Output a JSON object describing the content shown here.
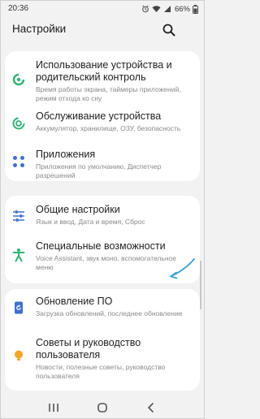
{
  "status": {
    "time": "20:36",
    "battery": "66%"
  },
  "header": {
    "title": "Настройки"
  },
  "items": [
    {
      "title_l1": "Использование устройства и",
      "title_l2": "родительский контроль",
      "sub_l1": "Время работы экрана, таймеры приложений,",
      "sub_l2": "режим отхода ко сну"
    },
    {
      "title_l1": "Обслуживание устройства",
      "sub_l1": "Аккумулятор, хранилище, ОЗУ, безопасность"
    },
    {
      "title_l1": "Приложения",
      "sub_l1": "Приложения по умолчанию, Диспетчер",
      "sub_l2": "разрешений"
    },
    {
      "title_l1": "Общие настройки",
      "sub_l1": "Язык и ввод, Дата и время, Сброс"
    },
    {
      "title_l1": "Специальные возможности",
      "sub_l1": "Voice Assistant, звук моно, вспомогательное",
      "sub_l2": "меню"
    },
    {
      "title_l1": "Обновление ПО",
      "sub_l1": "Загрузка обновлений, последнее обновление"
    },
    {
      "title_l1": "Советы и руководство",
      "title_l2": "пользователя",
      "sub_l1": "Новости, полезные советы, руководство",
      "sub_l2": "пользователя"
    }
  ],
  "colors": {
    "green": "#2bb673",
    "blue": "#3f6fd6",
    "orange": "#f5a623",
    "accent_arrow": "#3aa3d8"
  },
  "icons": [
    "wellbeing-icon",
    "device-care-icon",
    "apps-icon",
    "general-management-icon",
    "accessibility-icon",
    "software-update-icon",
    "tips-icon"
  ]
}
